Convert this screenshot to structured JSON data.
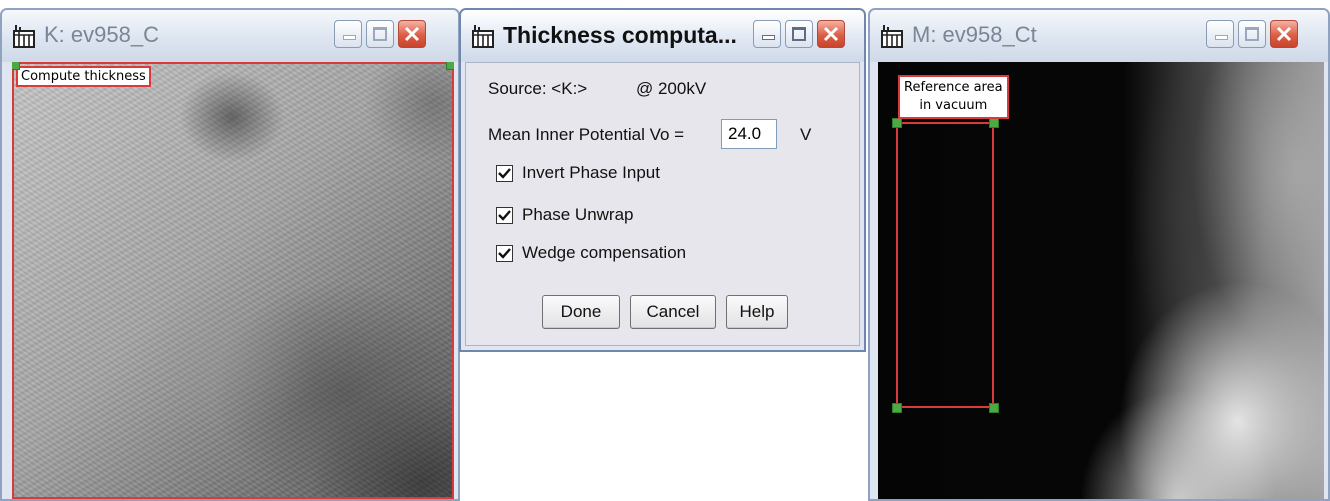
{
  "left_window": {
    "title": "K: ev958_C",
    "roi_label": "Compute thickness"
  },
  "dialog": {
    "title": "Thickness computa...",
    "source_label": "Source: <K:>",
    "voltage_label": "@ 200kV",
    "mip_label": "Mean Inner Potential  Vo =",
    "mip_value": "24.0",
    "mip_unit": "V",
    "checkboxes": [
      {
        "label": "Invert Phase Input",
        "checked": true
      },
      {
        "label": "Phase Unwrap",
        "checked": true
      },
      {
        "label": "Wedge compensation",
        "checked": true
      }
    ],
    "buttons": {
      "done": "Done",
      "cancel": "Cancel",
      "help": "Help"
    }
  },
  "right_window": {
    "title": "M: ev958_Ct",
    "ref_label_line1": "Reference area",
    "ref_label_line2": "in vacuum"
  },
  "icons": {
    "app": "app-window-icon",
    "minimize": "minimize-icon",
    "maximize": "maximize-icon",
    "close": "close-icon",
    "check": "checkmark-icon"
  },
  "colors": {
    "roi_red": "#d93a3a",
    "handle_green": "#4caa44",
    "close_red": "#dd5d45"
  }
}
